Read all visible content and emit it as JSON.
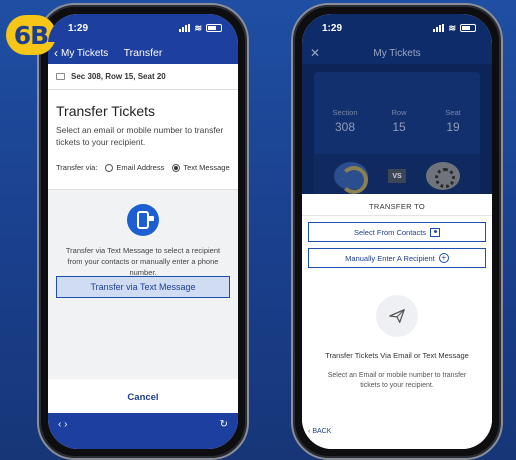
{
  "badge": "6B",
  "left_phone": {
    "status_time": "1:29",
    "nav": {
      "back_label": "My Tickets",
      "title": "Transfer"
    },
    "seat_info": "Sec 308, Row 15, Seat 20",
    "heading": "Transfer Tickets",
    "description": "Select an email or mobile number to transfer tickets to your recipient.",
    "transfer_via_label": "Transfer via:",
    "options": [
      {
        "label": "Email Address",
        "selected": false
      },
      {
        "label": "Text Message",
        "selected": true
      }
    ],
    "sms_description": "Transfer via Text Message to select a recipient from your contacts or manually enter a phone number.",
    "primary_button": "Transfer via Text Message",
    "cancel_button": "Cancel"
  },
  "right_phone": {
    "status_time": "1:29",
    "header_title": "My Tickets",
    "seat": [
      {
        "label": "Section",
        "value": "308"
      },
      {
        "label": "Row",
        "value": "15"
      },
      {
        "label": "Seat",
        "value": "19"
      }
    ],
    "vs_label": "VS",
    "sheet_title": "TRANSFER TO",
    "select_contacts": "Select From Contacts",
    "manual_recipient": "Manually Enter A Recipient",
    "email_title": "Transfer Tickets Via Email or Text Message",
    "email_description": "Select an Email or mobile number to transfer tickets to your recipient.",
    "back_label": "BACK"
  },
  "colors": {
    "background": "#1f4fa3",
    "nav_blue": "#1d3fa0",
    "badge_yellow": "#f5c518",
    "button_outline": "#1d4fb0"
  }
}
